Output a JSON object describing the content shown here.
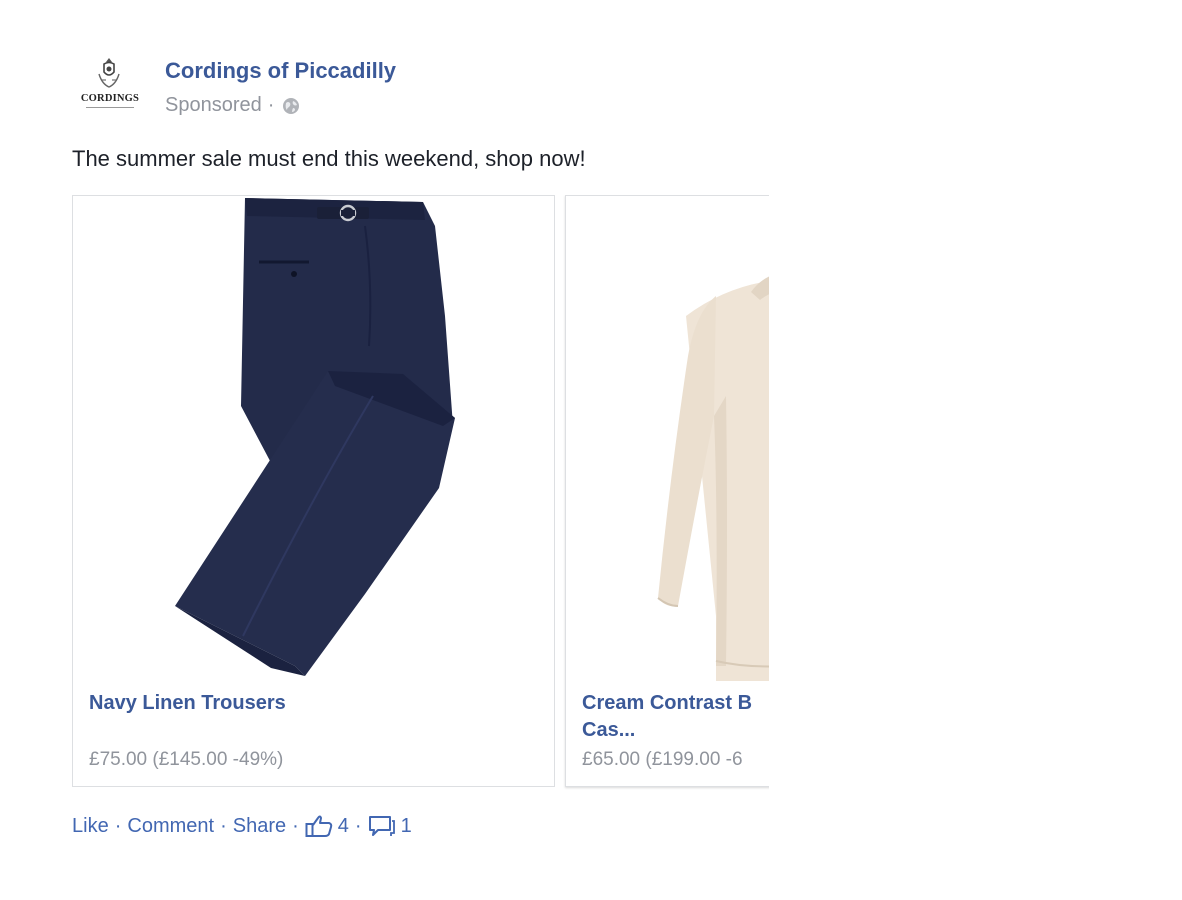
{
  "post": {
    "page_name": "Cordings of Piccadilly",
    "sponsored_label": "Sponsored",
    "separator": "·",
    "avatar_text": "CORDINGS",
    "message": "The summer sale must end this weekend, shop now!"
  },
  "carousel": {
    "cards": [
      {
        "title": "Navy Linen Trousers",
        "price": "£75.00 (£145.00 -49%)",
        "image": "navy-trousers"
      },
      {
        "title": "Cream Contrast B\nCas...",
        "title_line1": "Cream Contrast B",
        "title_line2": "Cas...",
        "price": "£65.00 (£199.00 -6",
        "image": "cream-jumper"
      }
    ]
  },
  "actions": {
    "like": "Like",
    "comment": "Comment",
    "share": "Share",
    "like_count": "4",
    "comment_count": "1",
    "separator": "·"
  },
  "colors": {
    "link": "#3b5998",
    "meta": "#90949c",
    "action": "#4267b2",
    "trousers": "#232b4a",
    "jumper": "#efe4d6"
  },
  "icons": [
    "crest-icon",
    "globe-icon",
    "thumbs-up-icon",
    "comment-bubble-icon"
  ]
}
